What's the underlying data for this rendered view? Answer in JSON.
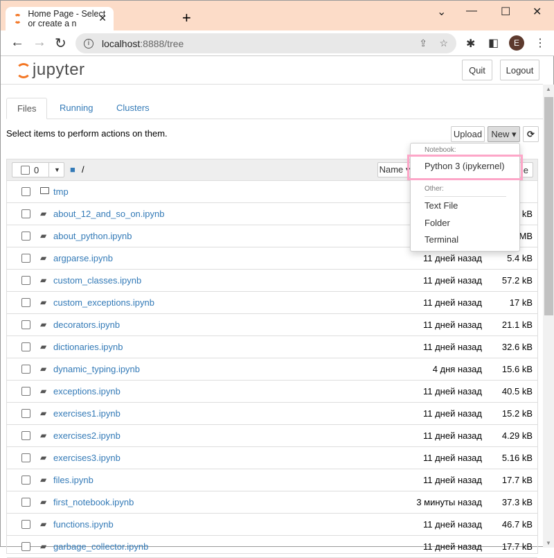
{
  "browser": {
    "tab_title": "Home Page - Select or create a n",
    "url_host": "localhost",
    "url_rest": ":8888/tree",
    "avatar_letter": "E"
  },
  "header": {
    "logo_text": "jupyter",
    "quit": "Quit",
    "logout": "Logout"
  },
  "tabs": [
    "Files",
    "Running",
    "Clusters"
  ],
  "toolbar": {
    "hint": "Select items to perform actions on them.",
    "upload": "Upload",
    "new": "New ▾",
    "refresh_icon": "refresh-icon",
    "selected_count": "0",
    "path": "/",
    "sort_label": "Name ▾",
    "last_col_fragment": "e"
  },
  "dropdown": {
    "notebook_header": "Notebook:",
    "python": "Python 3 (ipykernel)",
    "other_header": "Other:",
    "text_file": "Text File",
    "folder": "Folder",
    "terminal": "Terminal"
  },
  "files": [
    {
      "name": "tmp",
      "type": "folder",
      "modified": "",
      "size": ""
    },
    {
      "name": "about_12_and_so_on.ipynb",
      "type": "notebook",
      "modified": "",
      "size": "kB"
    },
    {
      "name": "about_python.ipynb",
      "type": "notebook",
      "modified": "",
      "size": "MB"
    },
    {
      "name": "argparse.ipynb",
      "type": "notebook",
      "modified": "11 дней назад",
      "size": "5.4 kB"
    },
    {
      "name": "custom_classes.ipynb",
      "type": "notebook",
      "modified": "11 дней назад",
      "size": "57.2 kB"
    },
    {
      "name": "custom_exceptions.ipynb",
      "type": "notebook",
      "modified": "11 дней назад",
      "size": "17 kB"
    },
    {
      "name": "decorators.ipynb",
      "type": "notebook",
      "modified": "11 дней назад",
      "size": "21.1 kB"
    },
    {
      "name": "dictionaries.ipynb",
      "type": "notebook",
      "modified": "11 дней назад",
      "size": "32.6 kB"
    },
    {
      "name": "dynamic_typing.ipynb",
      "type": "notebook",
      "modified": "4 дня назад",
      "size": "15.6 kB"
    },
    {
      "name": "exceptions.ipynb",
      "type": "notebook",
      "modified": "11 дней назад",
      "size": "40.5 kB"
    },
    {
      "name": "exercises1.ipynb",
      "type": "notebook",
      "modified": "11 дней назад",
      "size": "15.2 kB"
    },
    {
      "name": "exercises2.ipynb",
      "type": "notebook",
      "modified": "11 дней назад",
      "size": "4.29 kB"
    },
    {
      "name": "exercises3.ipynb",
      "type": "notebook",
      "modified": "11 дней назад",
      "size": "5.16 kB"
    },
    {
      "name": "files.ipynb",
      "type": "notebook",
      "modified": "11 дней назад",
      "size": "17.7 kB"
    },
    {
      "name": "first_notebook.ipynb",
      "type": "notebook",
      "modified": "3 минуты назад",
      "size": "37.3 kB"
    },
    {
      "name": "functions.ipynb",
      "type": "notebook",
      "modified": "11 дней назад",
      "size": "46.7 kB"
    },
    {
      "name": "garbage_collector.ipynb",
      "type": "notebook",
      "modified": "11 дней назад",
      "size": "17.7 kB"
    }
  ],
  "colors": {
    "accent": "#337ab7",
    "jupyter_orange": "#f37726",
    "highlight": "#fda6c8"
  }
}
